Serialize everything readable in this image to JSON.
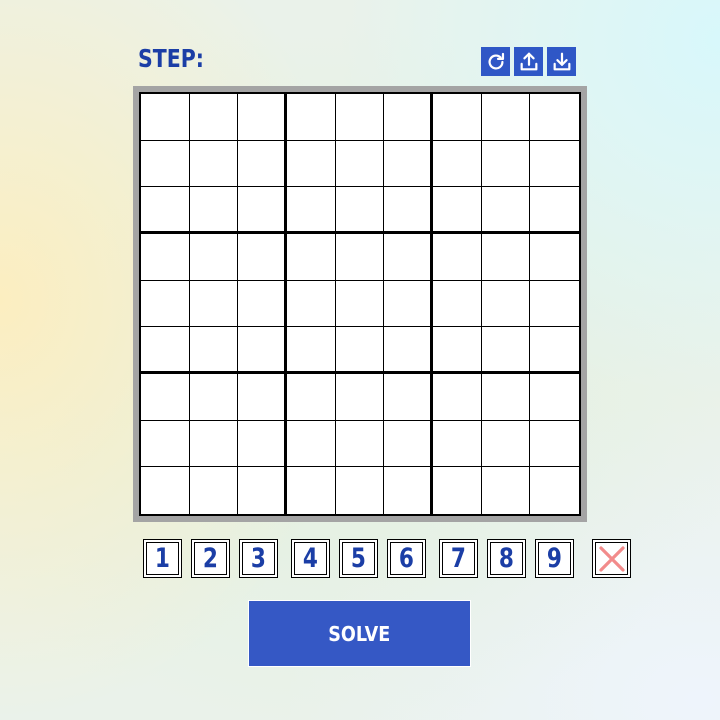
{
  "header": {
    "step_label": "STEP:"
  },
  "toolbar": {
    "buttons": [
      {
        "icon": "refresh-icon"
      },
      {
        "icon": "upload-icon"
      },
      {
        "icon": "download-icon"
      }
    ]
  },
  "board": {
    "size": 9,
    "box_size": 3,
    "cells": [
      [
        "",
        "",
        "",
        "",
        "",
        "",
        "",
        "",
        ""
      ],
      [
        "",
        "",
        "",
        "",
        "",
        "",
        "",
        "",
        ""
      ],
      [
        "",
        "",
        "",
        "",
        "",
        "",
        "",
        "",
        ""
      ],
      [
        "",
        "",
        "",
        "",
        "",
        "",
        "",
        "",
        ""
      ],
      [
        "",
        "",
        "",
        "",
        "",
        "",
        "",
        "",
        ""
      ],
      [
        "",
        "",
        "",
        "",
        "",
        "",
        "",
        "",
        ""
      ],
      [
        "",
        "",
        "",
        "",
        "",
        "",
        "",
        "",
        ""
      ],
      [
        "",
        "",
        "",
        "",
        "",
        "",
        "",
        "",
        ""
      ],
      [
        "",
        "",
        "",
        "",
        "",
        "",
        "",
        "",
        ""
      ]
    ]
  },
  "digit_pad": {
    "digits": [
      "1",
      "2",
      "3",
      "4",
      "5",
      "6",
      "7",
      "8",
      "9"
    ],
    "clear_icon": "close-icon"
  },
  "solve": {
    "label": "SOLVE"
  },
  "colors": {
    "accent": "#2f57c6",
    "text_blue": "#1b3ea6",
    "clear_red": "#f28b8b",
    "frame_gray": "#a4a4a4"
  }
}
